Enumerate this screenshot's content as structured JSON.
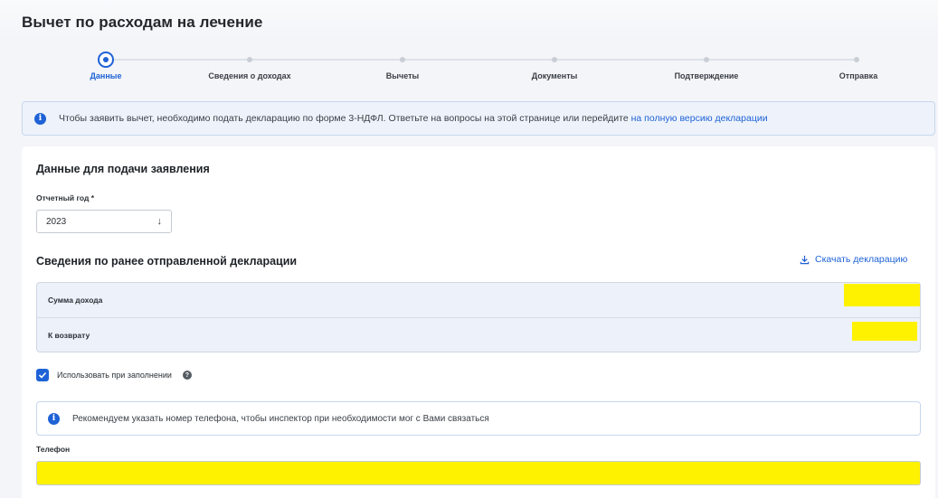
{
  "page": {
    "title": "Вычет по расходам на лечение"
  },
  "stepper": {
    "steps": [
      {
        "label": "Данные",
        "active": true
      },
      {
        "label": "Сведения о доходах",
        "active": false
      },
      {
        "label": "Вычеты",
        "active": false
      },
      {
        "label": "Документы",
        "active": false
      },
      {
        "label": "Подтверждение",
        "active": false
      },
      {
        "label": "Отправка",
        "active": false
      }
    ]
  },
  "info_banner": {
    "icon": "info-icon",
    "text": "Чтобы заявить вычет, необходимо подать декларацию по форме 3-НДФЛ. Ответьте на вопросы на этой странице или перейдите ",
    "link_text": "на полную версию декларации"
  },
  "form": {
    "section_title": "Данные для подачи заявления",
    "year_label": "Отчетный год *",
    "year_value": "2023",
    "year_arrow": "↓",
    "previous_title": "Сведения по ранее отправленной декларации",
    "download_label": "Скачать декларацию",
    "summary_rows": [
      {
        "label": "Сумма дохода"
      },
      {
        "label": "К возврату"
      }
    ],
    "use_checkbox_label": "Использовать при заполнении",
    "use_checkbox_checked": true,
    "help_icon_glyph": "?",
    "phone_hint": "Рекомендуем указать номер телефона, чтобы инспектор при необходимости мог с Вами связаться",
    "phone_label": "Телефон"
  },
  "colors": {
    "accent": "#1e62d6",
    "redaction": "#fff200",
    "banner_bg": "#eef3fb"
  }
}
